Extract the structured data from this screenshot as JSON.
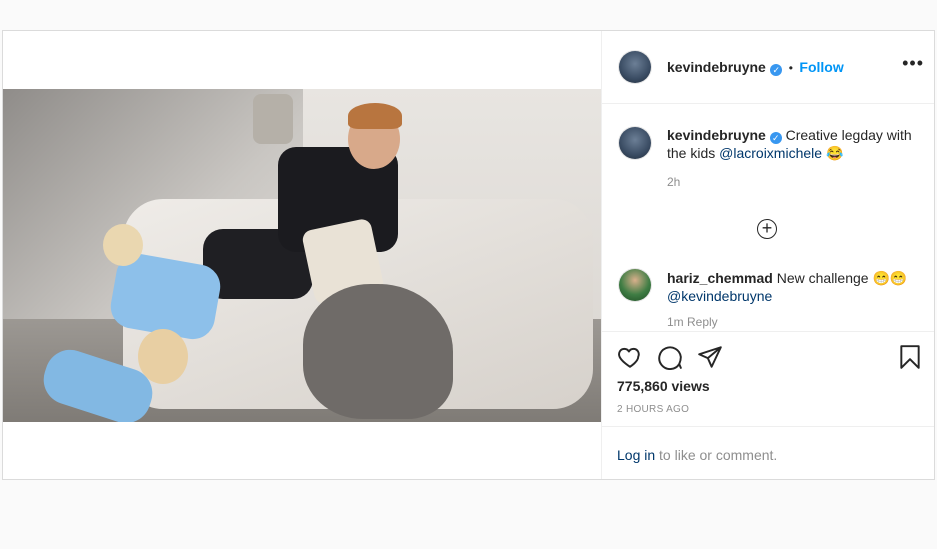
{
  "post": {
    "username": "kevindebruyne",
    "verified_glyph": "✓",
    "separator": "•",
    "follow_label": "Follow",
    "more_glyph": "•••",
    "caption": {
      "username": "kevindebruyne",
      "text": "Creative legday with the kids",
      "mention": "@lacroixmichele",
      "emoji": "😂",
      "age": "2h"
    },
    "load_more_glyph": "+",
    "comments": [
      {
        "username": "hariz_chemmad",
        "text": "New challenge 😁😁",
        "mention": "@kevindebruyne",
        "meta": "1m   Reply"
      }
    ],
    "views": "775,860 views",
    "timestamp": "2 HOURS AGO",
    "login": {
      "link": "Log in",
      "rest": " to like or comment."
    }
  },
  "icons": {
    "like": "heart-icon",
    "comment": "comment-icon",
    "share": "paper-plane-icon",
    "save": "bookmark-icon"
  },
  "colors": {
    "link": "#0095f6",
    "verified": "#3897f0",
    "mention": "#00376b",
    "muted": "#8e8e8e"
  }
}
